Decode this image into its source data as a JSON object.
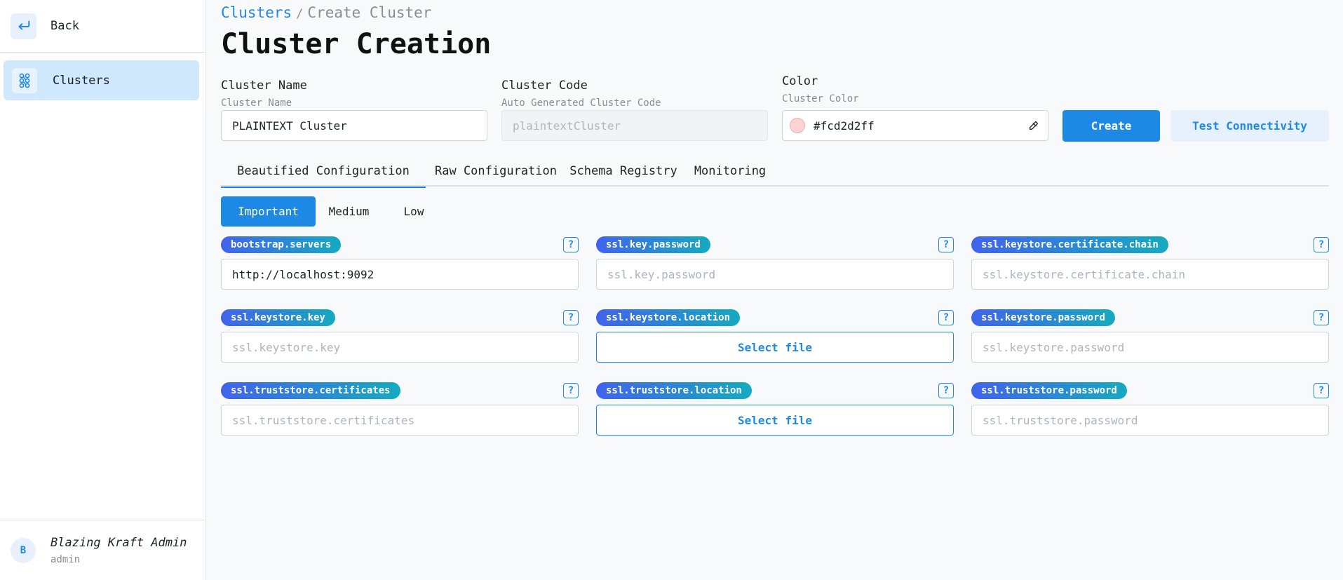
{
  "sidebar": {
    "back_label": "Back",
    "nav_item_label": "Clusters",
    "user": {
      "avatar_initial": "B",
      "name": "Blazing Kraft Admin",
      "role": "admin"
    }
  },
  "breadcrumb": {
    "root": "Clusters",
    "separator": "/",
    "current": "Create Cluster"
  },
  "page_title": "Cluster Creation",
  "form": {
    "name": {
      "label": "Cluster Name",
      "description": "Cluster Name",
      "value": "PLAINTEXT Cluster"
    },
    "code": {
      "label": "Cluster Code",
      "description": "Auto Generated Cluster Code",
      "placeholder": "plaintextCluster"
    },
    "color": {
      "label": "Color",
      "description": "Cluster Color",
      "value": "#fcd2d2ff",
      "swatch": "#fcd2d2"
    },
    "create_label": "Create",
    "test_label": "Test Connectivity"
  },
  "tabs": [
    "Beautified Configuration",
    "Raw Configuration",
    "Schema Registry",
    "Monitoring"
  ],
  "priority": [
    "Important",
    "Medium",
    "Low"
  ],
  "config": [
    {
      "key": "bootstrap.servers",
      "value": "http://localhost:9092",
      "placeholder": "",
      "type": "text"
    },
    {
      "key": "ssl.key.password",
      "value": "",
      "placeholder": "ssl.key.password",
      "type": "text"
    },
    {
      "key": "ssl.keystore.certificate.chain",
      "value": "",
      "placeholder": "ssl.keystore.certificate.chain",
      "type": "text"
    },
    {
      "key": "ssl.keystore.key",
      "value": "",
      "placeholder": "ssl.keystore.key",
      "type": "text"
    },
    {
      "key": "ssl.keystore.location",
      "file_label": "Select file",
      "type": "file"
    },
    {
      "key": "ssl.keystore.password",
      "value": "",
      "placeholder": "ssl.keystore.password",
      "type": "text"
    },
    {
      "key": "ssl.truststore.certificates",
      "value": "",
      "placeholder": "ssl.truststore.certificates",
      "type": "text"
    },
    {
      "key": "ssl.truststore.location",
      "file_label": "Select file",
      "type": "file"
    },
    {
      "key": "ssl.truststore.password",
      "value": "",
      "placeholder": "ssl.truststore.password",
      "type": "text"
    }
  ],
  "help_glyph": "?",
  "colors": {
    "accent": "#1e88e5",
    "badge_start": "#4263eb",
    "badge_end": "#15aabf",
    "active_nav": "#d0e8fb"
  }
}
